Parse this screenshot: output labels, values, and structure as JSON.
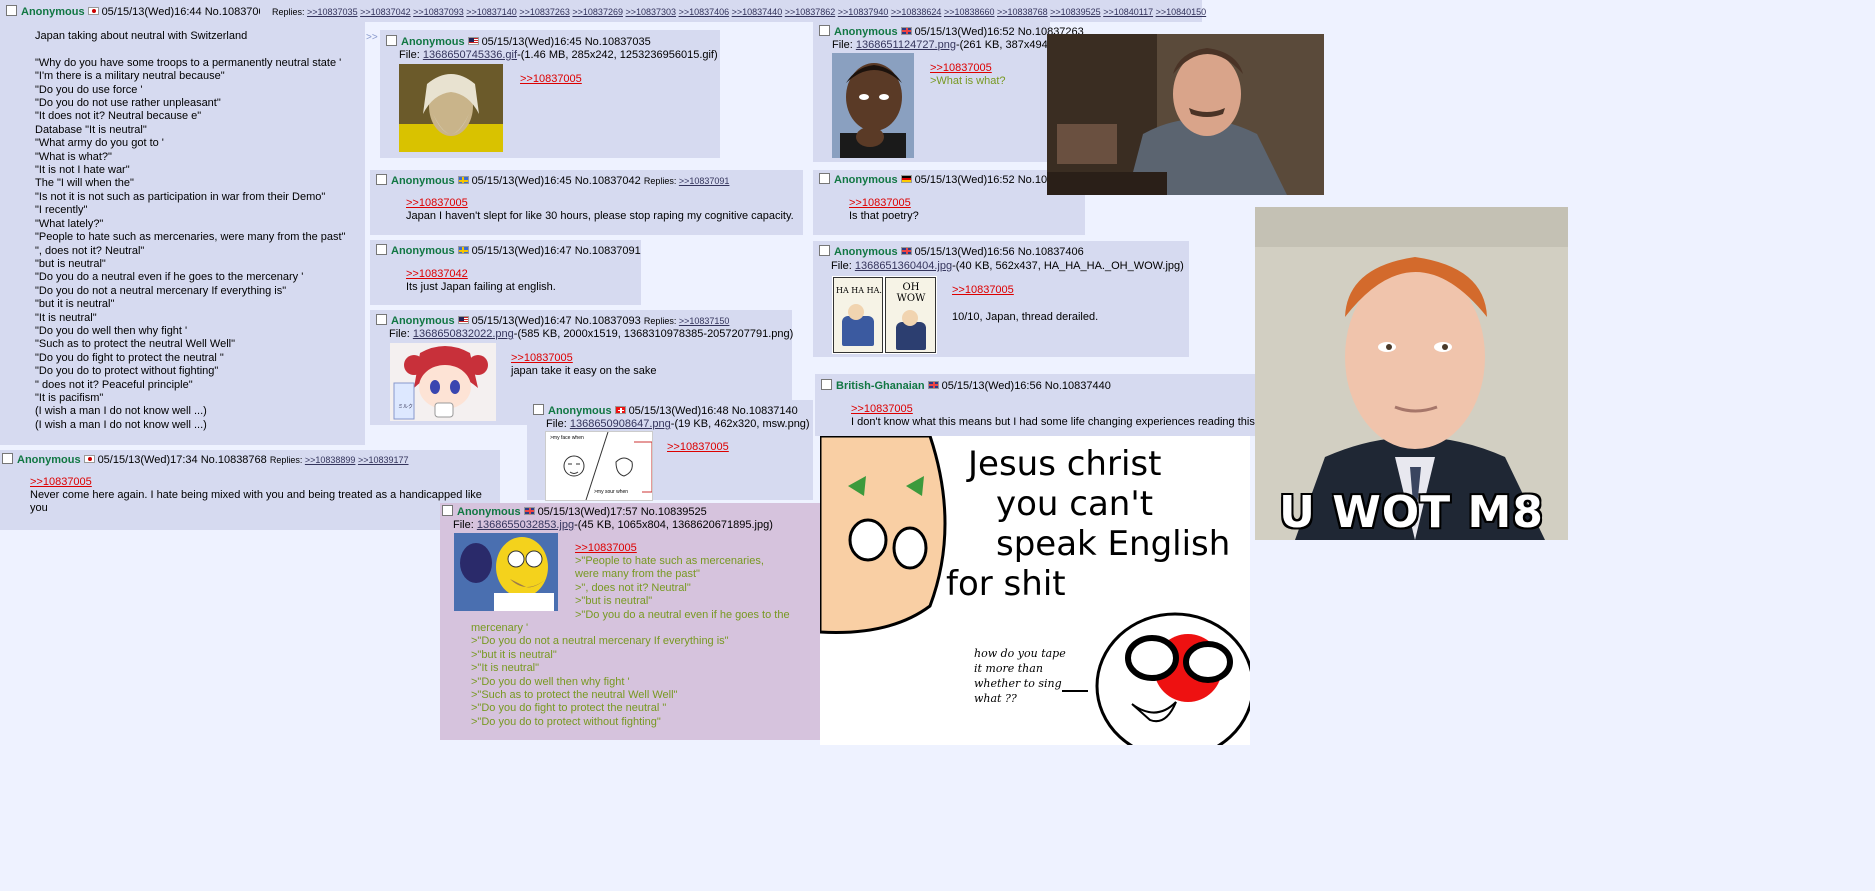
{
  "op": {
    "name": "Anonymous",
    "date": "05/15/13(Wed)16:44",
    "no": "No.10837005",
    "replies_label": "Replies:",
    "replies": [
      ">>10837035",
      ">>10837042",
      ">>10837093",
      ">>10837140",
      ">>10837263",
      ">>10837269",
      ">>10837303",
      ">>10837406",
      ">>10837440",
      ">>10837862",
      ">>10837940",
      ">>10838624",
      ">>10838660",
      ">>10838768",
      ">>10839525",
      ">>10840117",
      ">>10840150"
    ],
    "lines": [
      "Japan taking about neutral with Switzerland",
      "",
      "\"Why do you have some troops to a permanently neutral state '",
      "\"I'm there is a military neutral because\"",
      "\"Do you do use force '",
      "\"Do you do not use rather unpleasant\"",
      "\"It does not it? Neutral because e\"",
      "Database \"It is neutral\"",
      "\"What army do you got to '",
      "\"What is what?\"",
      "\"It is not I hate war\"",
      "The \"I will when the\"",
      "\"Is not it is not such as participation in war from their Demo\"",
      "\"I recently\"",
      "\"What lately?\"",
      "\"People to hate such as mercenaries, were many from the past\"",
      "\", does not it? Neutral\"",
      "\"but is neutral\"",
      "\"Do you do a neutral even if he goes to the mercenary '",
      "\"Do you do not a neutral mercenary If everything is\"",
      "\"but it is neutral\"",
      "\"It is neutral\"",
      "\"Do you do well then why fight '",
      "\"Such as to protect the neutral Well Well\"",
      "\"Do you do fight to protect the neutral \"",
      "\"Do you do to protect without fighting\"",
      "\" does not it? Peaceful principle\"",
      "\"It is pacifism\"",
      "(I wish a man I do not know well ...)",
      "(I wish a man I do not know well ...)"
    ]
  },
  "p_10837035": {
    "name": "Anonymous",
    "date": "05/15/13(Wed)16:45",
    "no": "No.10837035",
    "file_label": "File:",
    "file_link": "1368650745336.gif",
    "file_info": "-(1.46 MB, 285x242, 1253236956015.gif)",
    "quote": ">>10837005"
  },
  "p_10837042": {
    "name": "Anonymous",
    "date": "05/15/13(Wed)16:45",
    "no": "No.10837042",
    "replies_label": "Replies:",
    "replies": [
      ">>10837091"
    ],
    "quote": ">>10837005",
    "text": "Japan I haven't slept for like 30 hours, please stop raping my cognitive capacity."
  },
  "p_10837091": {
    "name": "Anonymous",
    "date": "05/15/13(Wed)16:47",
    "no": "No.10837091",
    "quote": ">>10837042",
    "text": "Its just Japan failing at english."
  },
  "p_10837093": {
    "name": "Anonymous",
    "date": "05/15/13(Wed)16:47",
    "no": "No.10837093",
    "replies_label": "Replies:",
    "replies": [
      ">>10837150"
    ],
    "file_label": "File:",
    "file_link": "1368650832022.png",
    "file_info": "-(585 KB, 2000x1519, 1368310978385-2057207791.png)",
    "quote": ">>10837005",
    "text": "japan take it easy on the sake",
    "thumb_text": "ミルク"
  },
  "p_10837140": {
    "name": "Anonymous",
    "date": "05/15/13(Wed)16:48",
    "no": "No.10837140",
    "file_label": "File:",
    "file_link": "1368650908647.png",
    "file_info": "-(19 KB, 462x320, msw.png)",
    "quote": ">>10837005",
    "thumb_text_1": ">my face when",
    "thumb_text_2": ">my sour when"
  },
  "p_10838768": {
    "name": "Anonymous",
    "date": "05/15/13(Wed)17:34",
    "no": "No.10838768",
    "replies_label": "Replies:",
    "replies": [
      ">>10838899",
      ">>10839177"
    ],
    "quote": ">>10837005",
    "text": "Never come here again. I hate being mixed with you and being treated as a handicapped like you"
  },
  "p_10839525": {
    "name": "Anonymous",
    "date": "05/15/13(Wed)17:57",
    "no": "No.10839525",
    "file_label": "File:",
    "file_link": "1368655032853.jpg",
    "file_info": "-(45 KB, 1065x804, 1368620671895.jpg)",
    "quote": ">>10837005",
    "green_wrapped": [
      ">\"People to hate such as mercenaries,",
      "were many from the past\"",
      ">\", does not it? Neutral\"",
      ">\"but is neutral\"",
      ">\"Do you do a neutral even if he goes to the"
    ],
    "green_full": [
      "mercenary '",
      ">\"Do you do not a neutral mercenary If everything is\"",
      ">\"but it is neutral\"",
      ">\"It is neutral\"",
      ">\"Do you do well then why fight '",
      ">\"Such as to protect the neutral Well Well\"",
      ">\"Do you do fight to protect the neutral \"",
      ">\"Do you do to protect without fighting\""
    ]
  },
  "p_10837263": {
    "name": "Anonymous",
    "date": "05/15/13(Wed)16:52",
    "no": "No.10837263",
    "file_label": "File:",
    "file_link": "1368651124727.png",
    "file_info": "-(261 KB, 387x494,",
    "quote": ">>10837005",
    "green": ">What is what?"
  },
  "p_10837269": {
    "name": "Anonymous",
    "date": "05/15/13(Wed)16:52",
    "no": "No.10",
    "quote": ">>10837005",
    "text": "Is that poetry?"
  },
  "p_10837406": {
    "name": "Anonymous",
    "date": "05/15/13(Wed)16:56",
    "no": "No.10837406",
    "file_label": "File:",
    "file_link": "1368651360404.jpg",
    "file_info": "-(40 KB, 562x437, HA_HA_HA._OH_WOW.jpg)",
    "quote": ">>10837005",
    "text": "10/10, Japan, thread derailed.",
    "thumb_text_1": "HA HA HA.",
    "thumb_text_2": "OH WOW"
  },
  "p_10837440": {
    "name": "British-Ghanaian",
    "date": "05/15/13(Wed)16:56",
    "no": "No.10837440",
    "quote": ">>10837005",
    "text": "I don't know what this means but I had some life changing experiences reading this."
  },
  "polandball": {
    "line1": "Jesus christ",
    "line2": "you can't",
    "line3": "speak English",
    "line4": "for shit",
    "small1": "how do you tape",
    "small2": "it more than",
    "small3": "whether to sing",
    "small4": "what ??"
  },
  "meme": {
    "caption": "U WOT M8"
  },
  "colors": {
    "post_bg": "#d6daf0",
    "page_bg": "#eef2ff",
    "name_green": "#117743",
    "quote_red": "#dd0000",
    "greentext": "#789922",
    "highlight_bg": "#d6c3dd"
  }
}
